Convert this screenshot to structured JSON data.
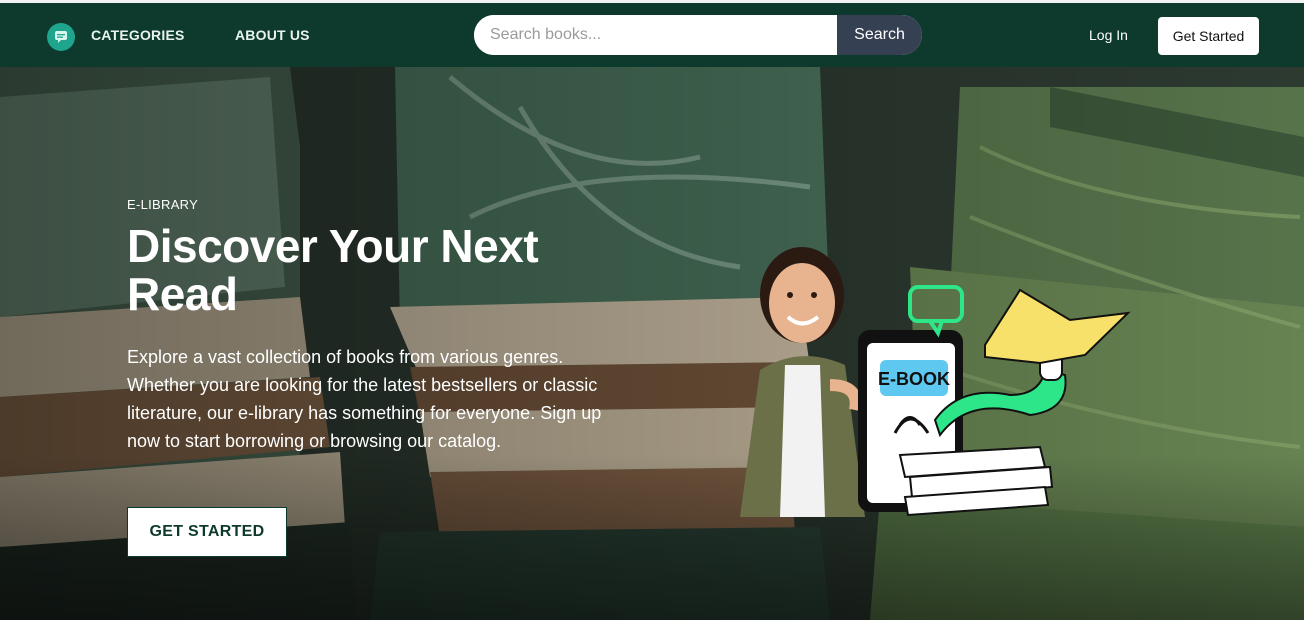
{
  "nav": {
    "categories": "CATEGORIES",
    "about": "ABOUT US",
    "search_placeholder": "Search books...",
    "search_button": "Search",
    "login": "Log In",
    "get_started": "Get Started"
  },
  "hero": {
    "kicker": "E-LIBRARY",
    "title": "Discover Your Next Read",
    "description": "Explore a vast collection of books from various genres. Whether you are looking for the latest bestsellers or classic literature, our e-library has something for everyone. Sign up now to start borrowing or browsing our catalog.",
    "cta": "GET STARTED",
    "illustration_label": "E-BOOK"
  },
  "colors": {
    "nav_bg": "#0d3a2c",
    "search_button_bg": "#354052",
    "logo": "#1fa58e",
    "accent_green": "#2ee68a",
    "accent_yellow": "#f7e16a"
  },
  "icons": [
    "chat-book-logo-icon"
  ]
}
